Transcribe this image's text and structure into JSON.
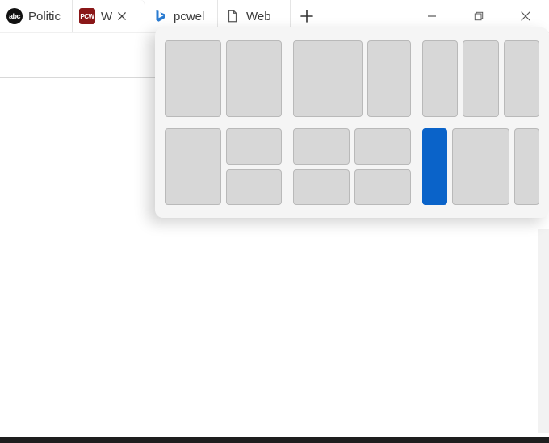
{
  "tabs": [
    {
      "label": "Politic",
      "icon_text": "abc",
      "active": false,
      "closable": false
    },
    {
      "label": "W",
      "icon_text": "PCW",
      "active": true,
      "closable": true
    },
    {
      "label": "pcwel",
      "icon": "bing",
      "active": false,
      "closable": false
    },
    {
      "label": "Web",
      "icon": "page",
      "active": false,
      "closable": false
    }
  ],
  "new_tab_label": "New tab",
  "window_controls": {
    "minimize": "Minimize",
    "restore": "Restore",
    "close": "Close"
  },
  "snap_panel": {
    "selected_layout_index": 5,
    "selected_tile_index": 0,
    "layouts": [
      {
        "type": "2col",
        "tiles": 2
      },
      {
        "type": "1-2",
        "tiles": 2
      },
      {
        "type": "3col",
        "tiles": 3
      },
      {
        "type": "1-2row",
        "tiles": 3
      },
      {
        "type": "4",
        "tiles": 4
      },
      {
        "type": "3col-wide",
        "tiles": 3
      }
    ]
  }
}
